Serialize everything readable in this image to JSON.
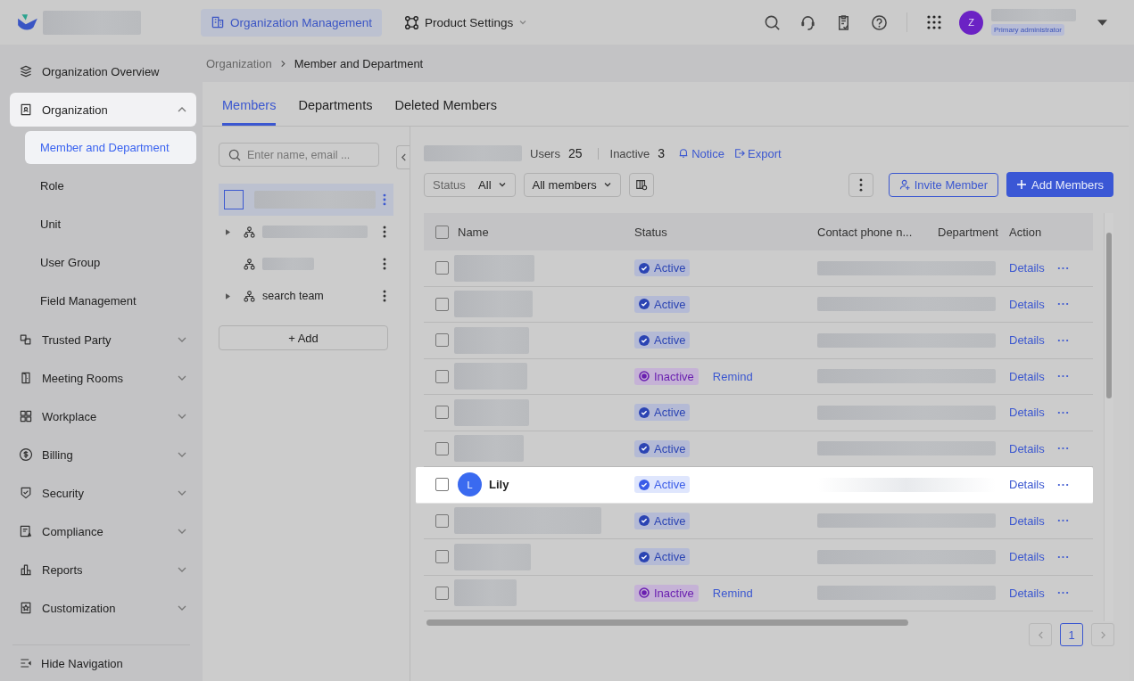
{
  "topbar": {
    "nav": [
      {
        "label": "Organization Management",
        "selected": true
      },
      {
        "label": "Product Settings",
        "selected": false
      }
    ],
    "avatar": "Z",
    "role_badge": "Primary administrator"
  },
  "sidebar": {
    "items": [
      {
        "label": "Organization Overview"
      },
      {
        "label": "Organization",
        "expanded": true,
        "children": [
          {
            "label": "Member and Department",
            "selected": true
          },
          {
            "label": "Role",
            "selected": false
          },
          {
            "label": "Unit",
            "selected": false
          },
          {
            "label": "User Group",
            "selected": false
          },
          {
            "label": "Field Management",
            "selected": false
          }
        ]
      },
      {
        "label": "Trusted Party",
        "expanded": false
      },
      {
        "label": "Meeting Rooms",
        "expanded": false
      },
      {
        "label": "Workplace",
        "expanded": false
      },
      {
        "label": "Billing",
        "expanded": false
      },
      {
        "label": "Security",
        "expanded": false
      },
      {
        "label": "Compliance",
        "expanded": false
      },
      {
        "label": "Reports",
        "expanded": false
      },
      {
        "label": "Customization",
        "expanded": false
      }
    ],
    "footer": "Hide Navigation"
  },
  "breadcrumb": [
    "Organization",
    "Member and Department"
  ],
  "tabs": [
    {
      "label": "Members",
      "selected": true
    },
    {
      "label": "Departments",
      "selected": false
    },
    {
      "label": "Deleted Members",
      "selected": false
    }
  ],
  "tree": {
    "search": {
      "placeholder": "Enter name, email ..."
    },
    "nodes": [
      {
        "kind": "root",
        "selected": true
      },
      {
        "kind": "redacted",
        "expandable": true,
        "selected": false
      },
      {
        "kind": "redacted",
        "expandable": false,
        "selected": false
      },
      {
        "kind": "named",
        "label": "search team",
        "expandable": true,
        "selected": false
      }
    ],
    "add_button": "+ Add"
  },
  "summary": {
    "users_label": "Users",
    "users_count": "25",
    "inactive_label": "Inactive",
    "inactive_count": "3",
    "notice": "Notice",
    "export": "Export"
  },
  "filters": {
    "status_label": "Status",
    "status_value": "All",
    "members_value": "All members"
  },
  "buttons": {
    "invite": "Invite Member",
    "add": "Add Members"
  },
  "table": {
    "columns": [
      "Name",
      "Status",
      "Contact phone n...",
      "Department",
      "Action"
    ],
    "all_checked": false,
    "rows": [
      {
        "kind": "redacted",
        "checked": false,
        "active": true,
        "status": "Active",
        "highlighted": false,
        "action": "Details"
      },
      {
        "kind": "redacted",
        "checked": false,
        "active": true,
        "status": "Active",
        "highlighted": false,
        "action": "Details"
      },
      {
        "kind": "redacted",
        "checked": false,
        "active": true,
        "status": "Active",
        "highlighted": false,
        "action": "Details"
      },
      {
        "kind": "redacted",
        "checked": false,
        "active": false,
        "status": "Inactive",
        "remind": "Remind",
        "highlighted": false,
        "action": "Details"
      },
      {
        "kind": "redacted",
        "checked": false,
        "active": true,
        "status": "Active",
        "highlighted": false,
        "action": "Details"
      },
      {
        "kind": "redacted",
        "checked": false,
        "active": true,
        "status": "Active",
        "highlighted": false,
        "action": "Details"
      },
      {
        "kind": "named",
        "name": "Lily",
        "avatar": "L",
        "checked": false,
        "active": true,
        "status": "Active",
        "highlighted": true,
        "action": "Details"
      },
      {
        "kind": "redacted",
        "checked": false,
        "active": true,
        "status": "Active",
        "highlighted": false,
        "action": "Details"
      },
      {
        "kind": "redacted",
        "checked": false,
        "active": true,
        "status": "Active",
        "highlighted": false,
        "action": "Details"
      },
      {
        "kind": "redacted",
        "checked": false,
        "active": false,
        "status": "Inactive",
        "remind": "Remind",
        "highlighted": false,
        "action": "Details"
      }
    ]
  },
  "pagination": {
    "pages": [
      {
        "label": "1",
        "selected": true
      }
    ]
  }
}
